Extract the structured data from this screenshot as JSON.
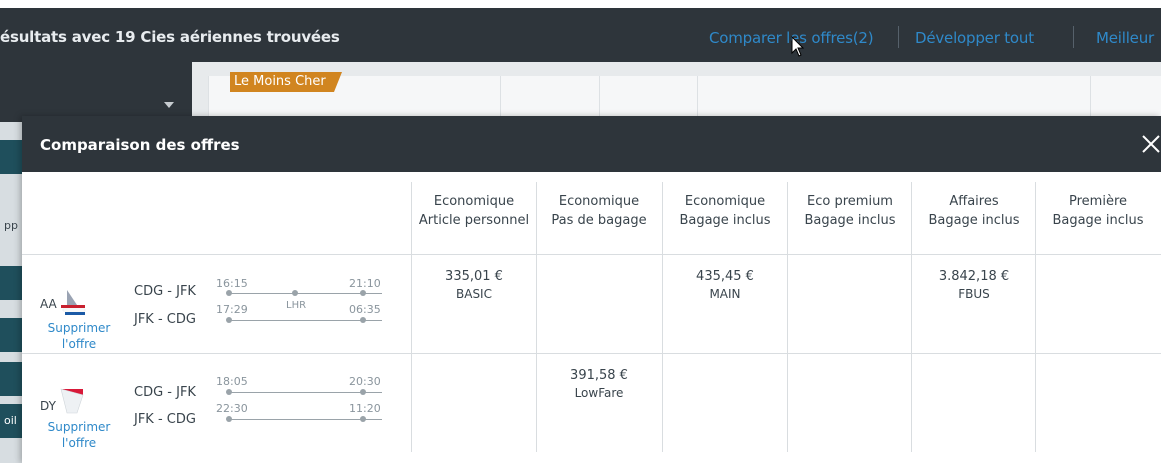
{
  "topbar": {
    "title": "ésultats avec 19 Cies aériennes trouvées",
    "compare_link": "Comparer les offres(2)",
    "expand_link": "Développer tout",
    "best_link": "Meilleur"
  },
  "background": {
    "cheapest_badge": "Le Moins Cher",
    "left_fragments": [
      "pp",
      "oil"
    ]
  },
  "modal": {
    "title": "Comparaison des offres",
    "columns": [
      {
        "line1": "Economique",
        "line2": "Article personnel"
      },
      {
        "line1": "Economique",
        "line2": "Pas de bagage"
      },
      {
        "line1": "Economique",
        "line2": "Bagage inclus"
      },
      {
        "line1": "Eco premium",
        "line2": "Bagage inclus"
      },
      {
        "line1": "Affaires",
        "line2": "Bagage inclus"
      },
      {
        "line1": "Première",
        "line2": "Bagage inclus"
      }
    ],
    "remove_line1": "Supprimer",
    "remove_line2": "l'offre",
    "offers": [
      {
        "airline": "AA",
        "outbound": {
          "route": "CDG - JFK",
          "dep": "16:15",
          "arr": "21:10",
          "stop": "LHR"
        },
        "inbound": {
          "route": "JFK - CDG",
          "dep": "17:29",
          "arr": "06:35"
        },
        "fares": [
          {
            "price": "335,01 €",
            "name": "BASIC"
          },
          {
            "price": "",
            "name": ""
          },
          {
            "price": "435,45 €",
            "name": "MAIN"
          },
          {
            "price": "",
            "name": ""
          },
          {
            "price": "3.842,18 €",
            "name": "FBUS"
          },
          {
            "price": "",
            "name": ""
          }
        ]
      },
      {
        "airline": "DY",
        "outbound": {
          "route": "CDG - JFK",
          "dep": "18:05",
          "arr": "20:30"
        },
        "inbound": {
          "route": "JFK - CDG",
          "dep": "22:30",
          "arr": "11:20"
        },
        "fares": [
          {
            "price": "",
            "name": ""
          },
          {
            "price": "391,58 €",
            "name": "LowFare"
          },
          {
            "price": "",
            "name": ""
          },
          {
            "price": "",
            "name": ""
          },
          {
            "price": "",
            "name": ""
          },
          {
            "price": "",
            "name": ""
          }
        ]
      }
    ]
  },
  "colors": {
    "header_bg": "#2e353b",
    "link": "#2f89c9",
    "badge": "#d18520",
    "text": "#39444c"
  }
}
